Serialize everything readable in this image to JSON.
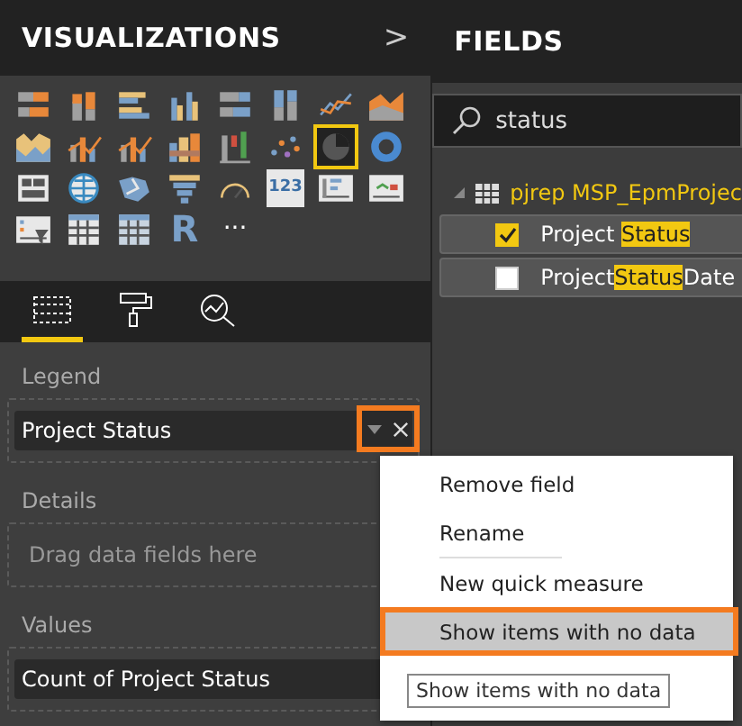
{
  "visualizations": {
    "title": "VISUALIZATIONS",
    "collapse_glyph": ">",
    "items": [
      {
        "kind": "stacked-bar",
        "selected": false
      },
      {
        "kind": "stacked-column",
        "selected": false
      },
      {
        "kind": "clustered-bar",
        "selected": false
      },
      {
        "kind": "clustered-column",
        "selected": false
      },
      {
        "kind": "bar100",
        "selected": false
      },
      {
        "kind": "column100",
        "selected": false
      },
      {
        "kind": "line",
        "selected": false
      },
      {
        "kind": "area",
        "selected": false
      },
      {
        "kind": "stacked-area",
        "selected": false
      },
      {
        "kind": "line-column",
        "selected": false
      },
      {
        "kind": "line-column",
        "selected": false
      },
      {
        "kind": "ribbon",
        "selected": false
      },
      {
        "kind": "waterfall",
        "selected": false
      },
      {
        "kind": "scatter",
        "selected": false
      },
      {
        "kind": "pie",
        "selected": true
      },
      {
        "kind": "donut",
        "selected": false
      },
      {
        "kind": "treemap",
        "selected": false
      },
      {
        "kind": "globe",
        "selected": false
      },
      {
        "kind": "filled-map",
        "selected": false
      },
      {
        "kind": "funnel",
        "selected": false
      },
      {
        "kind": "gauge",
        "selected": false
      },
      {
        "kind": "card",
        "label": "123",
        "selected": false
      },
      {
        "kind": "multirow-card",
        "selected": false
      },
      {
        "kind": "kpi",
        "selected": false
      },
      {
        "kind": "slicer",
        "selected": false
      },
      {
        "kind": "table",
        "selected": false
      },
      {
        "kind": "matrix",
        "selected": false
      },
      {
        "kind": "letter",
        "label": "R",
        "selected": false
      },
      {
        "kind": "more",
        "label": "···",
        "selected": false
      }
    ],
    "tabs": [
      {
        "kind": "fields",
        "selected": true
      },
      {
        "kind": "format",
        "selected": false
      },
      {
        "kind": "analytics",
        "selected": false
      }
    ],
    "wells": [
      {
        "label": "Legend",
        "field": "Project Status",
        "annotated": true
      },
      {
        "label": "Details",
        "placeholder": "Drag data fields here"
      },
      {
        "label": "Values",
        "field": "Count of Project Status",
        "annotated": false
      }
    ]
  },
  "fields": {
    "title": "FIELDS",
    "search": {
      "value": "status"
    },
    "tables": [
      {
        "name": "pjrep MSP_EpmProjec",
        "expanded": true,
        "children": [
          {
            "before": "Project ",
            "match": "Status",
            "checked": true
          },
          {
            "before": "Project",
            "match": "Status",
            "after": "Date",
            "checked": false
          }
        ]
      }
    ]
  },
  "context_menu": {
    "items": [
      {
        "kind": "item",
        "label": "Remove field",
        "selected": false
      },
      {
        "kind": "item",
        "label": "Rename",
        "selected": false
      },
      {
        "kind": "divider"
      },
      {
        "kind": "item",
        "label": "New quick measure",
        "selected": false
      },
      {
        "kind": "item",
        "label": "Show items with no data",
        "selected": true
      }
    ],
    "tooltip": "Show items with no data"
  }
}
